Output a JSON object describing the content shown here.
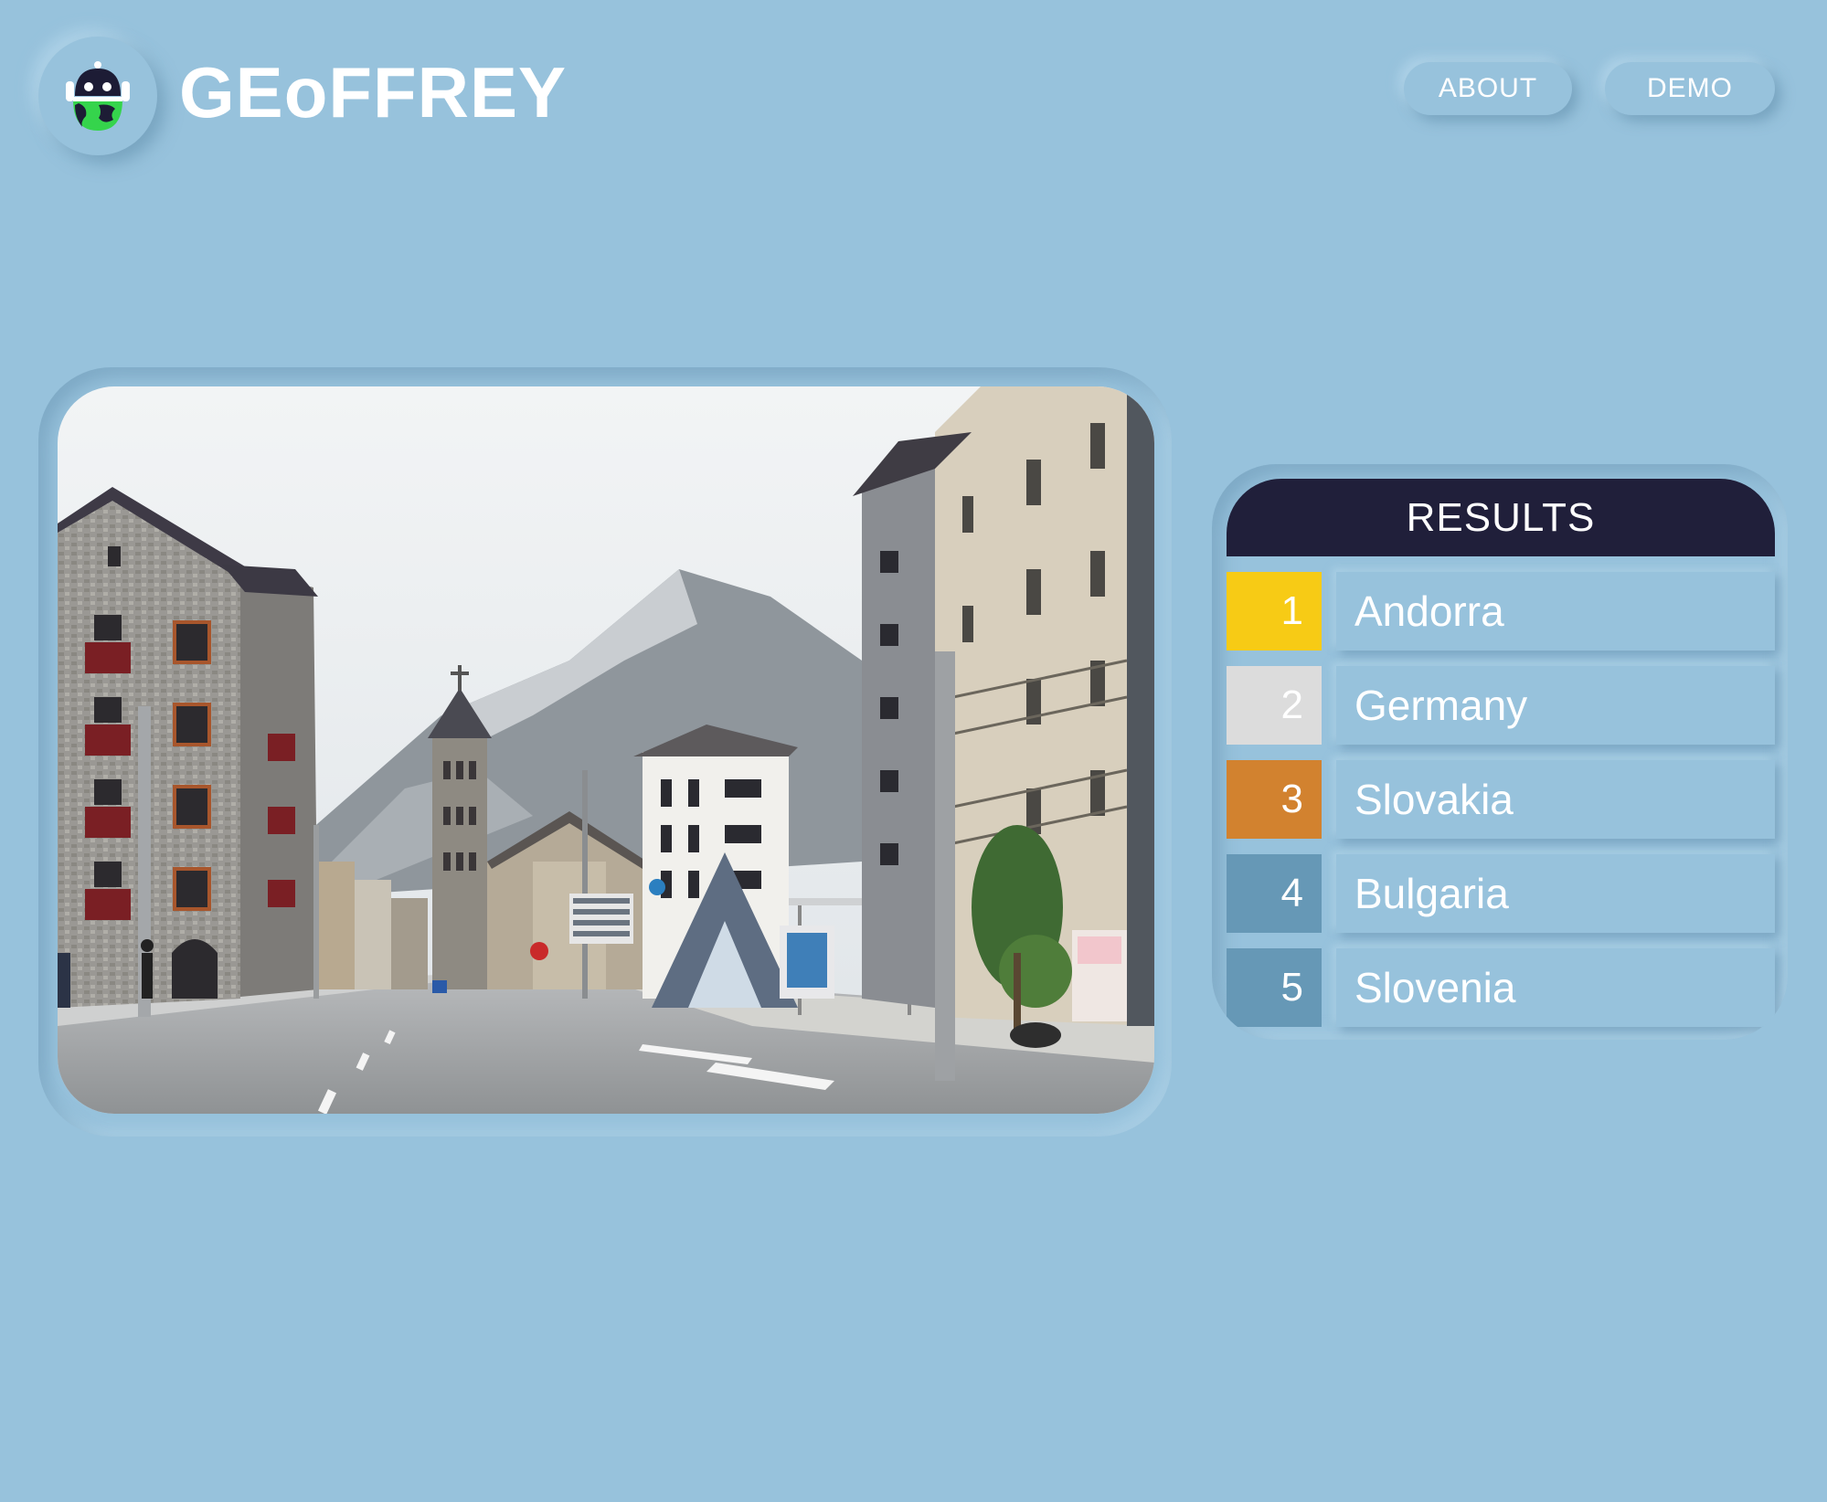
{
  "app": {
    "brand": "GEoFFREY",
    "logo_icon": "robot-globe-icon"
  },
  "nav": {
    "about_label": "ABOUT",
    "demo_label": "DEMO"
  },
  "photo": {
    "description_icon": "street-photo"
  },
  "results": {
    "title": "RESULTS",
    "items": [
      {
        "rank": "1",
        "country": "Andorra",
        "color": "#f7cb15"
      },
      {
        "rank": "2",
        "country": "Germany",
        "color": "#dcdcdc"
      },
      {
        "rank": "3",
        "country": "Slovakia",
        "color": "#d2822f"
      },
      {
        "rank": "4",
        "country": "Bulgaria",
        "color": "#6698b6"
      },
      {
        "rank": "5",
        "country": "Slovenia",
        "color": "#6698b6"
      }
    ]
  },
  "colors": {
    "background": "#97c2dc",
    "header_dark": "#201f3a",
    "text": "#ffffff"
  }
}
